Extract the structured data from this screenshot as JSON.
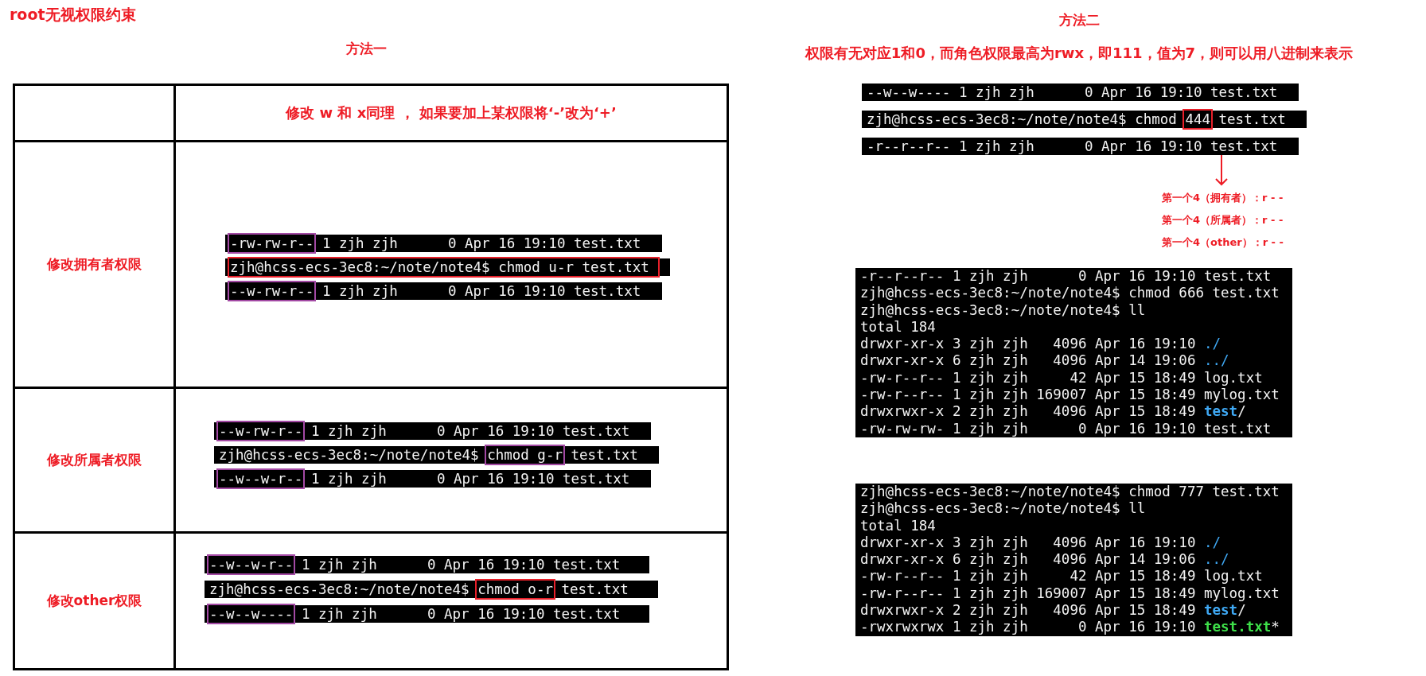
{
  "title": "root无视权限约束",
  "method_one": {
    "heading": "方法一",
    "header": "修改 w 和 x同理 ， 如果要加上某权限将‘-’改为‘+’",
    "rows": [
      {
        "label": "修改拥有者权限",
        "lines": [
          [
            {
              "text": "-rw-rw-r--",
              "color": "#a349a4"
            },
            {
              "text": " 1 zjh zjh      0 Apr 16 19:10 test.txt "
            }
          ],
          [
            {
              "text": "zjh@hcss-ecs-3ec8:~/note/note4$ chmod u-r test.txt ",
              "color": "#e8202a"
            }
          ],
          [
            {
              "text": "--w-rw-r--",
              "color": "#a349a4"
            },
            {
              "text": " 1 zjh zjh      0 Apr 16 19:10 test.txt "
            }
          ]
        ]
      },
      {
        "label": "修改所属者权限",
        "lines": [
          [
            {
              "text": "--w-rw-r--",
              "color": "#a349a4"
            },
            {
              "text": " 1 zjh zjh      0 Apr 16 19:10 test.txt "
            }
          ],
          [
            {
              "text": "zjh@hcss-ecs-3ec8:~/note/note4$ "
            },
            {
              "text": "chmod g-r",
              "color": "#a349a4"
            },
            {
              "text": " test.txt "
            }
          ],
          [
            {
              "text": "--w--w-r--",
              "color": "#a349a4"
            },
            {
              "text": " 1 zjh zjh      0 Apr 16 19:10 test.txt "
            }
          ]
        ]
      },
      {
        "label": "修改other权限",
        "lines": [
          [
            {
              "text": "--w--w-r--",
              "color": "#a349a4"
            },
            {
              "text": " 1 zjh zjh      0 Apr 16 19:10 test.txt  "
            }
          ],
          [
            {
              "text": "zjh@hcss-ecs-3ec8:~/note/note4$ "
            },
            {
              "text": "chmod o-r",
              "color": "#e8202a"
            },
            {
              "text": " test.txt  "
            }
          ],
          [
            {
              "text": "--w--w----",
              "color": "#a349a4"
            },
            {
              "text": " 1 zjh zjh      0 Apr 16 19:10 test.txt  "
            }
          ]
        ]
      }
    ]
  },
  "method_two": {
    "heading": "方法二",
    "subtitle": "权限有无对应1和0，而角色权限最高为rwx，即111，值为7，则可以用八进制来表示",
    "first_lines": [
      [
        {
          "text": "--w--w---- 1 zjh zjh      0 Apr 16 19:10 test.txt "
        }
      ],
      [
        {
          "text": "zjh@hcss-ecs-3ec8:~/note/note4$ chmod "
        },
        {
          "text": "444",
          "color": "#e8202a"
        },
        {
          "text": " test.txt "
        }
      ],
      [
        {
          "text": "-r--r--r-- 1 zjh zjh      0 Apr 16 19:10 test.txt "
        }
      ]
    ],
    "notes": [
      "第一个4（拥有者）：r - -",
      "第一个4（所属者）：r - -",
      "第一个4（other）：r - -"
    ],
    "blocks": [
      [
        [
          {
            "text": "-r--r--r-- 1 zjh zjh      0 Apr 16 19:10 test.txt"
          }
        ],
        [
          {
            "text": "zjh@hcss-ecs-3ec8:~/note/note4$ chmod 666 test.txt"
          }
        ],
        [
          {
            "text": "zjh@hcss-ecs-3ec8:~/note/note4$ ll"
          }
        ],
        [
          {
            "text": "total 184"
          }
        ],
        [
          {
            "text": "drwxr-xr-x 3 zjh zjh   4096 Apr 16 19:10 "
          },
          {
            "text": "./",
            "kind": "dir"
          }
        ],
        [
          {
            "text": "drwxr-xr-x 6 zjh zjh   4096 Apr 14 19:06 "
          },
          {
            "text": "../",
            "kind": "dir"
          }
        ],
        [
          {
            "text": "-rw-r--r-- 1 zjh zjh     42 Apr 15 18:49 log.txt"
          }
        ],
        [
          {
            "text": "-rw-r--r-- 1 zjh zjh 169007 Apr 15 18:49 mylog.txt"
          }
        ],
        [
          {
            "text": "drwxrwxr-x 2 zjh zjh   4096 Apr 15 18:49 "
          },
          {
            "text": "test",
            "kind": "dir_bold"
          },
          {
            "text": "/"
          }
        ],
        [
          {
            "text": "-rw-rw-rw- 1 zjh zjh      0 Apr 16 19:10 test.txt"
          }
        ]
      ],
      [
        [
          {
            "text": "zjh@hcss-ecs-3ec8:~/note/note4$ chmod 777 test.txt"
          }
        ],
        [
          {
            "text": "zjh@hcss-ecs-3ec8:~/note/note4$ ll"
          }
        ],
        [
          {
            "text": "total 184"
          }
        ],
        [
          {
            "text": "drwxr-xr-x 3 zjh zjh   4096 Apr 16 19:10 "
          },
          {
            "text": "./",
            "kind": "dir"
          }
        ],
        [
          {
            "text": "drwxr-xr-x 6 zjh zjh   4096 Apr 14 19:06 "
          },
          {
            "text": "../",
            "kind": "dir"
          }
        ],
        [
          {
            "text": "-rw-r--r-- 1 zjh zjh     42 Apr 15 18:49 log.txt"
          }
        ],
        [
          {
            "text": "-rw-r--r-- 1 zjh zjh 169007 Apr 15 18:49 mylog.txt"
          }
        ],
        [
          {
            "text": "drwxrwxr-x 2 zjh zjh   4096 Apr 15 18:49 "
          },
          {
            "text": "test",
            "kind": "dir_bold"
          },
          {
            "text": "/"
          }
        ],
        [
          {
            "text": "-rwxrwxrwx 1 zjh zjh      0 Apr 16 19:10 "
          },
          {
            "text": "test.txt",
            "kind": "exec"
          },
          {
            "text": "*"
          }
        ]
      ]
    ]
  }
}
